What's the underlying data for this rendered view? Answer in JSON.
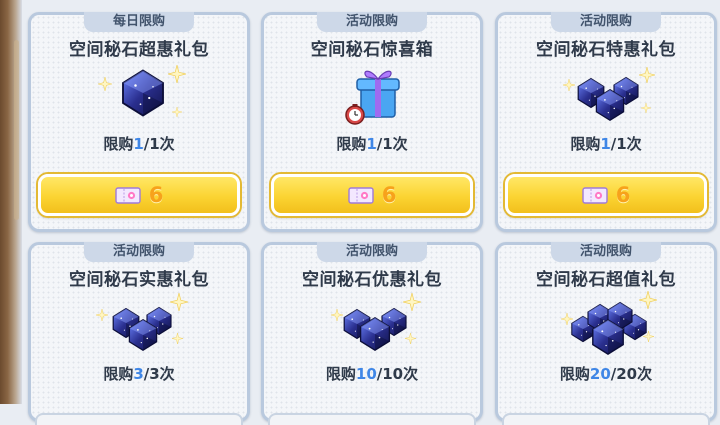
{
  "items": [
    {
      "tag": "每日限购",
      "title": "空间秘石超惠礼包",
      "limit_prefix": "限购",
      "limit_used": "1",
      "limit_total": "/1次",
      "price": "6",
      "art": "single-gem"
    },
    {
      "tag": "活动限购",
      "title": "空间秘石惊喜箱",
      "limit_prefix": "限购",
      "limit_used": "1",
      "limit_total": "/1次",
      "price": "6",
      "art": "gift-box"
    },
    {
      "tag": "活动限购",
      "title": "空间秘石特惠礼包",
      "limit_prefix": "限购",
      "limit_used": "1",
      "limit_total": "/1次",
      "price": "6",
      "art": "gem-pile-small"
    },
    {
      "tag": "活动限购",
      "title": "空间秘石实惠礼包",
      "limit_prefix": "限购",
      "limit_used": "3",
      "limit_total": "/3次",
      "art": "gem-pile-small"
    },
    {
      "tag": "活动限购",
      "title": "空间秘石优惠礼包",
      "limit_prefix": "限购",
      "limit_used": "10",
      "limit_total": "/10次",
      "art": "gem-pile-small"
    },
    {
      "tag": "活动限购",
      "title": "空间秘石超值礼包",
      "limit_prefix": "限购",
      "limit_used": "20",
      "limit_total": "/20次",
      "art": "gem-pile-large"
    }
  ],
  "icons": {
    "currency": "ticket-icon"
  },
  "colors": {
    "price": "#f7a21b",
    "count": "#3f86e6",
    "button": "#fbd432"
  }
}
